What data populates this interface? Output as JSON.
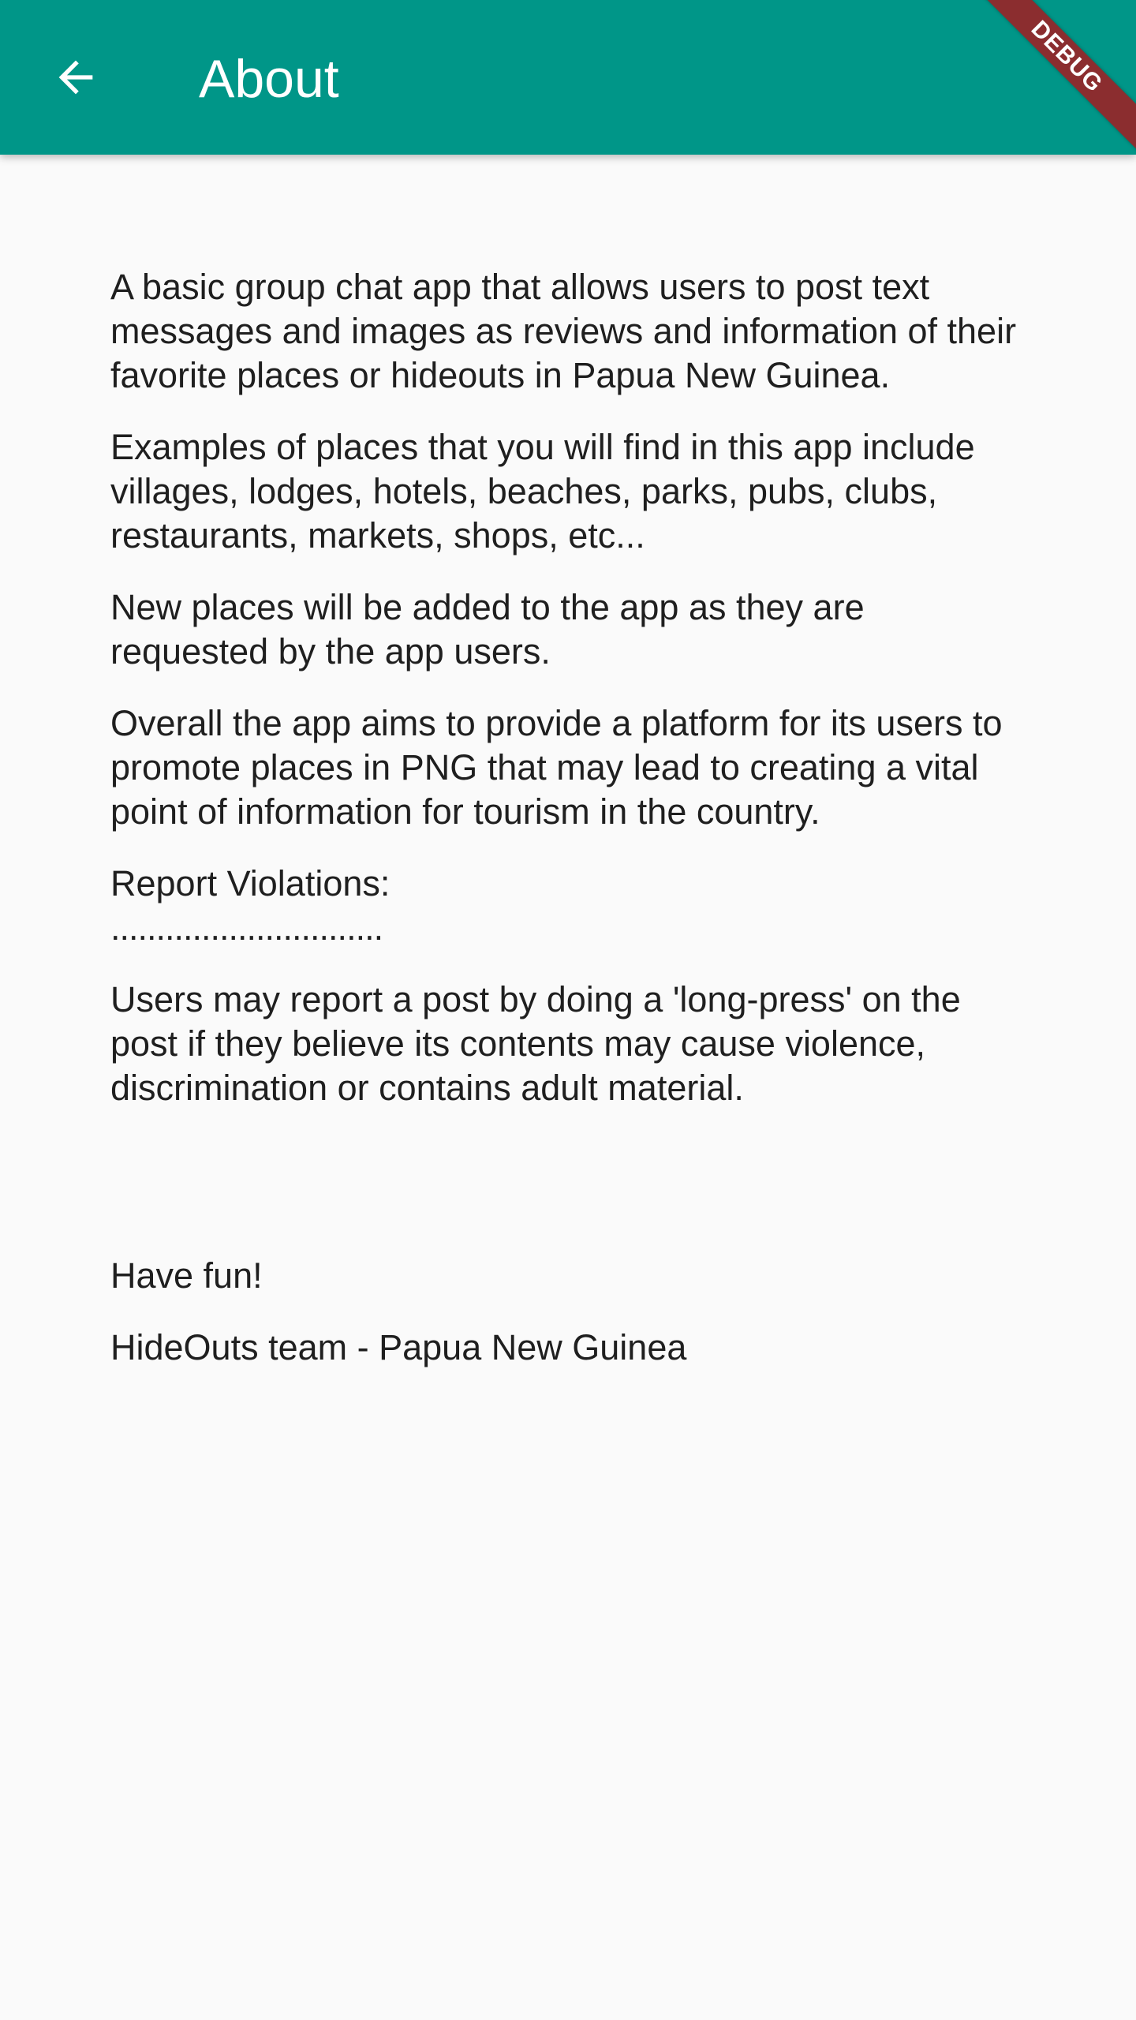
{
  "app_bar": {
    "title": "About",
    "back_icon": "arrow-back-icon",
    "background_color": "#009688"
  },
  "debug_banner": {
    "label": "DEBUG",
    "color": "#8b2d2f"
  },
  "content": {
    "paragraphs": [
      "A basic group chat app that allows users to post text messages and images as reviews and information of their favorite places or hideouts in Papua New Guinea.",
      "Examples of places that you will find in this app include villages, lodges, hotels, beaches, parks, pubs, clubs, restaurants, markets, shops, etc...",
      "New places will be added to the app as they are requested by the app users.",
      "Overall the app aims to provide a platform for its users to promote places in PNG that may lead to creating a vital point of information for tourism in the country."
    ],
    "report_heading": "Report Violations:",
    "report_divider": "..............................",
    "report_text": "Users may report a post by doing a 'long-press' on the post if they believe its contents may cause violence, discrimination or contains adult material.",
    "closing": "Have fun!",
    "signature": "HideOuts team - Papua New Guinea"
  }
}
